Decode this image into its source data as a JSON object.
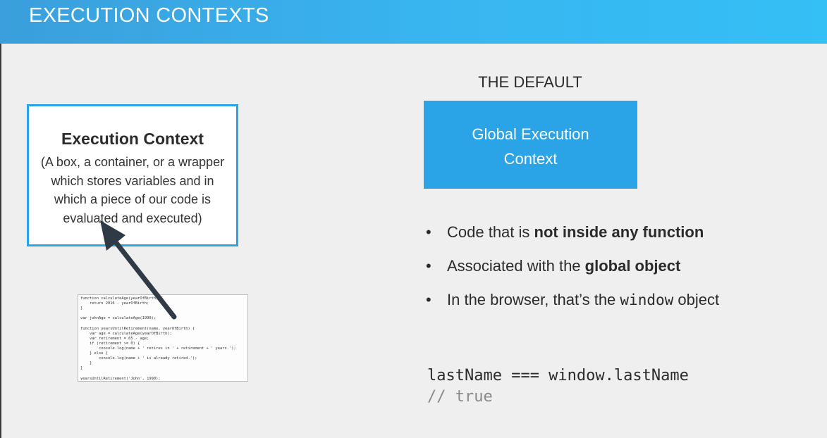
{
  "header": {
    "title": "EXECUTION CONTEXTS"
  },
  "execution_context_box": {
    "title": "Execution Context",
    "description": "(A box, a container, or a wrapper which stores variables and in which a piece of our code is evaluated and executed)"
  },
  "code_sample": {
    "lines": [
      "function calculateAge(yearOfBirth) {",
      "    return 2016 - yearOfBirth;",
      "}",
      "",
      "var johnAge = calculateAge(1990);",
      "",
      "function yearsUntilRetirement(name, yearOfBirth) {",
      "    var age = calculateAge(yearOfBirth);",
      "    var retirement = 65 - age;",
      "    if (retirement >= 0) {",
      "        console.log(name + ' retires in ' + retirement + ' years.');",
      "    } else {",
      "        console.log(name + ' is already retired.');",
      "    }",
      "}",
      "",
      "yearsUntilRetirement('John', 1990);"
    ]
  },
  "default_section": {
    "label": "THE DEFAULT",
    "box_line1": "Global Execution",
    "box_line2": "Context"
  },
  "bullets": {
    "b1_pre": "Code that is ",
    "b1_bold": "not inside any function",
    "b2_pre": "Associated with the ",
    "b2_bold": "global object",
    "b3_pre": "In the browser, that’s the ",
    "b3_code": "window",
    "b3_post": " object"
  },
  "code": {
    "line1": "lastName === window.lastName",
    "line2": "// true"
  },
  "colors": {
    "accent": "#2aa4e6",
    "header_gradient_start": "#3a9fdc",
    "header_gradient_end": "#34bff5"
  }
}
